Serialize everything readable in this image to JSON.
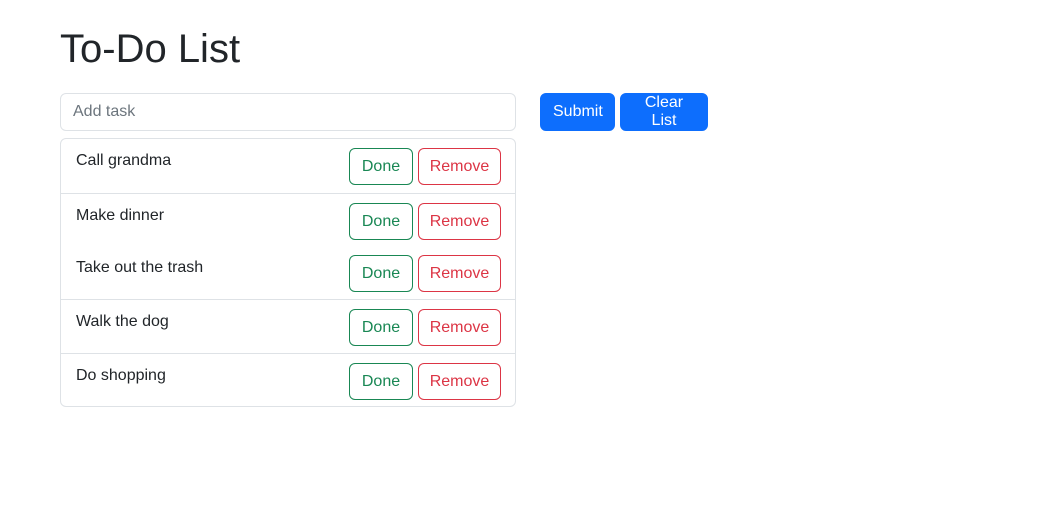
{
  "header": {
    "title": "To-Do List"
  },
  "form": {
    "input_placeholder": "Add task",
    "input_value": "",
    "submit_label": "Submit",
    "clear_label": "Clear List"
  },
  "tasks": [
    {
      "label": "Call grandma",
      "done_label": "Done",
      "remove_label": "Remove"
    },
    {
      "label": "Make dinner",
      "done_label": "Done",
      "remove_label": "Remove"
    },
    {
      "label": "Take out the trash",
      "done_label": "Done",
      "remove_label": "Remove"
    },
    {
      "label": "Walk the dog",
      "done_label": "Done",
      "remove_label": "Remove"
    },
    {
      "label": "Do shopping",
      "done_label": "Done",
      "remove_label": "Remove"
    }
  ],
  "colors": {
    "primary": "#0d6efd",
    "success": "#198754",
    "danger": "#dc3545",
    "border": "#dee2e6"
  }
}
